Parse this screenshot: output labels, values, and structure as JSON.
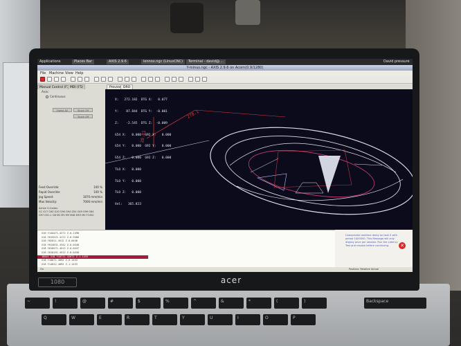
{
  "panel": {
    "applications": "Applications",
    "tasks": [
      "Places Bar",
      "AXIS 2.9.6",
      "lennox.ngc (LinuxCNC)",
      "Terminal - david@...."
    ],
    "user": "David pressure"
  },
  "window": {
    "title": "Y-minus.ngc - AXIS 2.9.6 on Acorn(0.9/1280)"
  },
  "menus": [
    "File",
    "Machine",
    "View",
    "Help"
  ],
  "left": {
    "tabs": [
      "Manual Control (F3)",
      "MDI (F5)"
    ],
    "axis_label": "Axis:",
    "modes": [
      "Continuous"
    ],
    "buttons": [
      "Home All",
      "Touch Off",
      "Touch Off"
    ],
    "sliders": [
      {
        "label": "Feed Override:",
        "value": "100 %"
      },
      {
        "label": "Rapid Override:",
        "value": "100 %"
      },
      {
        "label": "Jog Speed:",
        "value": "1870 mm/min"
      },
      {
        "label": "Max Velocity:",
        "value": "7000 mm/min"
      }
    ],
    "gcodes_label": "Active G-Codes:",
    "gcodes": [
      "G1 G17 G40 G20 G90 G94 G54 G49 G99 G64",
      "G97 G91.1 G8 M2 M5 M9 M48 M53 M0 F1000"
    ]
  },
  "preview": {
    "tabs": [
      "Preview",
      "DRO"
    ],
    "dro": [
      "X:   272.182  DTG X:   0.077",
      "Y:    87.844  DTG Y:  -0.001",
      "Z:    -2.545  DTG Z:  -0.009",
      "G54 X:   0.000  G92 X:   0.000",
      "G54 Y:   0.000  G92 Y:   0.000",
      "G54 Z:   0.000  G92 Z:   0.000",
      "TLO X:   0.000",
      "TLO Y:   0.000",
      "TLO Z:   0.000",
      "Vel:   365.823"
    ],
    "dimensions": [
      "278.1",
      "28.81"
    ]
  },
  "mdi": {
    "lines": [
      "X18 Y14A471.4272 Z-0.1498",
      "X18 Y015521.4172 Z-0.9466",
      "X18 Y02011.4512 Z-0.0448",
      "X18 Y014631.4342 Z-0.0448",
      "X18 Y010571.4512 Z-0.0437",
      "X18 Y010151.4512 Z-0.0438",
      "16641 X18 Y10711.42672 Z-1.1433",
      "X18 Y10071.4092 Z-0.1433",
      "X18 Y14012.4092 Z-1.1433"
    ],
    "active_index": 6
  },
  "notice": {
    "text": "Unexpected realtime delay on task 0 with period 1000000. This Message will only display once per session. Run the Latency Test and resolve before continuing.",
    "icon": "error-icon"
  },
  "status": {
    "left": "On",
    "right": "Position: Relative Actual"
  },
  "laptop": {
    "brand": "acer",
    "badge": "1080"
  },
  "keys": [
    "Backspace",
    "~",
    "!",
    "@",
    "#",
    "$",
    "%",
    "^",
    "&",
    "*",
    "(",
    ")",
    "Q",
    "W",
    "E",
    "R",
    "T",
    "Y",
    "U",
    "I",
    "O",
    "P"
  ]
}
